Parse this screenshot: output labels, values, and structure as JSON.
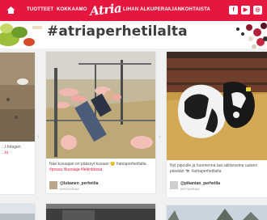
{
  "nav": {
    "items": [
      "TUOTTEET",
      "KOKKAAMO",
      "LIHAN ALKUPERA",
      "AJANKOHTAISTA"
    ],
    "logo": "Atria",
    "brand_color": "#e5173f",
    "social": [
      {
        "icon": "facebook-icon",
        "glyph": "f"
      },
      {
        "icon": "youtube-icon",
        "glyph": "▶"
      },
      {
        "icon": "instagram-icon",
        "glyph": "◎"
      }
    ]
  },
  "hashtag": "#atriaperhetilalta",
  "cards": {
    "left": {
      "caption_lines": [
        "...t fotogen",
        "...lu"
      ]
    },
    "middle": {
      "caption": "Nae kuvaajan on päässyt kuvaan 😊 #atriaperhetilalta",
      "tags": "#possu #kuvaaja #lekinbossa",
      "author": "@lukanen_perhetila",
      "source": "INSTAGRAM"
    },
    "right": {
      "caption": "Nyt pipoulle ja huomenna tasi aktiiviseina uuteen päivään 🐄 #atriaperhetilalta",
      "author": "@pikantan_perhetila",
      "source": "INSTAGRAM"
    }
  }
}
